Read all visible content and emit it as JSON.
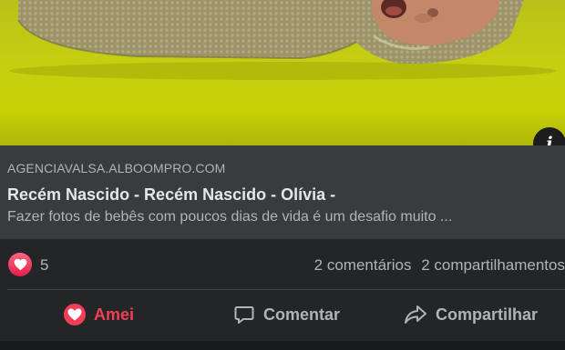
{
  "link_preview": {
    "domain": "AGENCIAVALSA.ALBOOMPRO.COM",
    "title": "Recém Nascido - Recém Nascido - Olívia -",
    "description": "Fazer fotos de bebês com poucos dias de vida é um desafio muito ...",
    "info_icon": "info-icon"
  },
  "stats": {
    "reaction_icon": "love-reaction-icon",
    "reaction_count": "5",
    "comments": "2 comentários",
    "shares": "2 compartilhamentos"
  },
  "actions": {
    "love_label": "Amei",
    "comment_label": "Comentar",
    "share_label": "Compartilhar"
  },
  "colors": {
    "background": "#242526",
    "link_box": "#3a3b3c",
    "love_red": "#f33e58",
    "photo_green": "#c6cf10"
  }
}
